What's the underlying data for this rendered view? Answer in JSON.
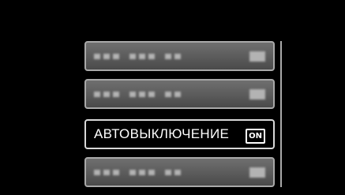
{
  "menu": {
    "items": [
      {
        "label": "",
        "value": "",
        "state": "blurred"
      },
      {
        "label": "",
        "value": "",
        "state": "blurred"
      },
      {
        "label": "АВТОВЫКЛЮЧЕНИЕ",
        "value": "ON",
        "state": "selected"
      },
      {
        "label": "",
        "value": "",
        "state": "blurred"
      }
    ]
  },
  "colors": {
    "background": "#000000",
    "item_fill": "#5a5a5a",
    "item_border": "#a9a9a9",
    "selected_border": "#d8d8d8",
    "text": "#ffffff"
  },
  "scrollbar": {
    "visible": true
  }
}
